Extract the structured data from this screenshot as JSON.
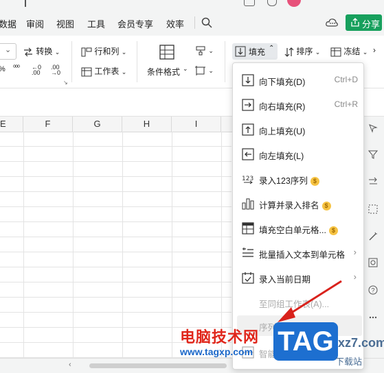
{
  "menu": {
    "items": [
      "数据",
      "审阅",
      "视图",
      "工具",
      "会员专享",
      "效率"
    ],
    "share_label": "分享"
  },
  "ribbon": {
    "convert": "转换",
    "row_col": "行和列",
    "worksheet": "工作表",
    "cond_format": "条件格式",
    "fill": "填充",
    "sort": "排序",
    "freeze": "冻结"
  },
  "columns": [
    "E",
    "F",
    "G",
    "H",
    "I"
  ],
  "dropdown": {
    "items": [
      {
        "label": "向下填充(D)",
        "shortcut": "Ctrl+D",
        "icon": "fill-down-icon"
      },
      {
        "label": "向右填充(R)",
        "shortcut": "Ctrl+R",
        "icon": "fill-right-icon"
      },
      {
        "label": "向上填充(U)",
        "shortcut": "",
        "icon": "fill-up-icon"
      },
      {
        "label": "向左填充(L)",
        "shortcut": "",
        "icon": "fill-left-icon"
      },
      {
        "label": "录入123序列",
        "shortcut": "",
        "icon": "sequence-123-icon"
      },
      {
        "label": "计算并录入排名",
        "shortcut": "",
        "icon": "rank-bars-icon"
      },
      {
        "label": "填充空白单元格...",
        "shortcut": "",
        "icon": "table-grid-icon"
      },
      {
        "label": "批量插入文本到单元格",
        "shortcut": "",
        "icon": "insert-text-icon"
      },
      {
        "label": "录入当前日期",
        "shortcut": "",
        "icon": "calendar-icon"
      },
      {
        "label": "至同组工作表(A)...",
        "shortcut": "",
        "icon": ""
      },
      {
        "label": "序列(S)...",
        "shortcut": "",
        "icon": ""
      },
      {
        "label": "智能填充",
        "shortcut": "",
        "icon": "smart-fill-icon"
      }
    ]
  },
  "watermark": {
    "cn": "电脑技术网",
    "url": "www.tagxp.com",
    "tag": "TAG",
    "xz7": "xz7.com",
    "xz7b": "下载站"
  },
  "colors": {
    "accent": "#17a05d",
    "watermark_red": "#e0261b",
    "watermark_blue": "#1d6fd0"
  }
}
